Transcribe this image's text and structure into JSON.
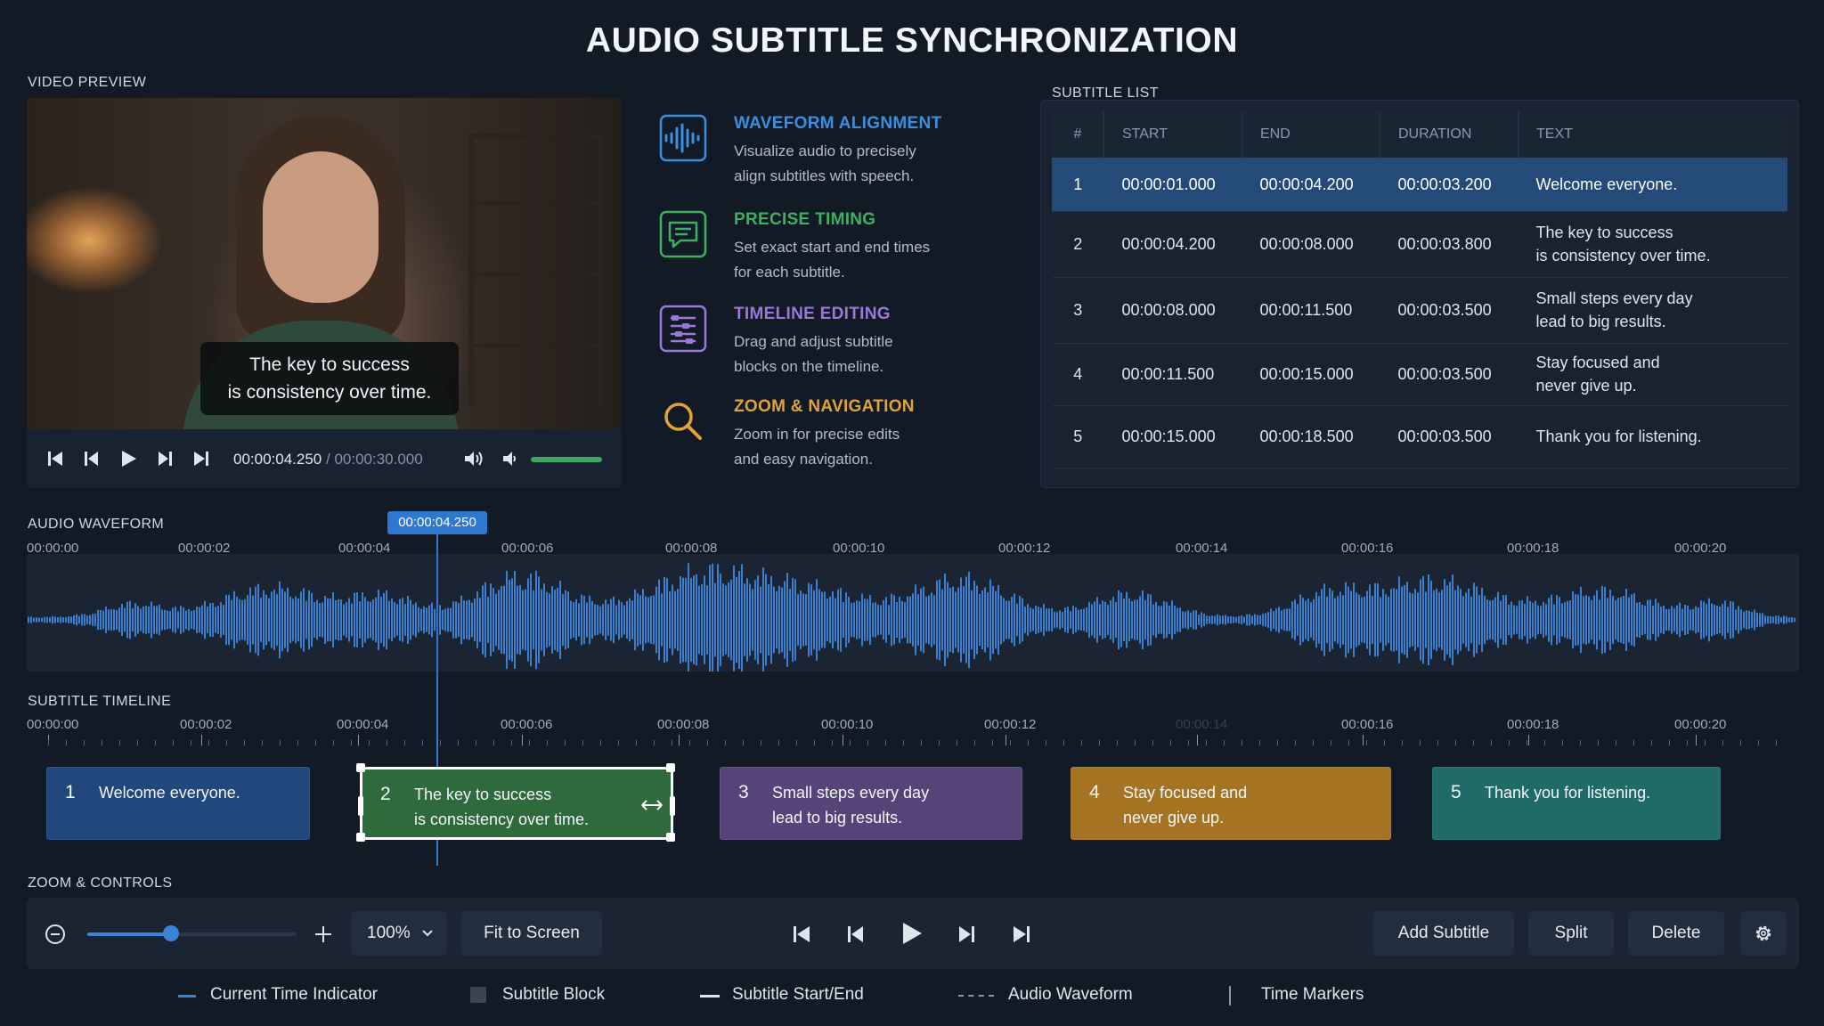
{
  "title": "AUDIO SUBTITLE SYNCHRONIZATION",
  "colors": {
    "background": "#121a25",
    "panel": "#182230",
    "accent_blue": "#3b83d6",
    "waveform": "#3a7fd0",
    "block_1": "#21477d",
    "block_2": "#2f6a3d",
    "block_3": "#564478",
    "block_4": "#a47422",
    "block_5": "#1f6b67"
  },
  "video_preview": {
    "label": "VIDEO PREVIEW",
    "subtitle_line1": "The key to success",
    "subtitle_line2": "is consistency over time.",
    "current_time": "00:00:04.250",
    "separator": " / ",
    "total_time": "00:00:30.000",
    "volume_level": 1.0,
    "icons": [
      "skip-to-start-icon",
      "previous-frame-icon",
      "play-icon",
      "next-frame-icon",
      "skip-to-end-icon",
      "volume-icon",
      "volume-low-icon"
    ]
  },
  "features": [
    {
      "title": "WAVEFORM ALIGNMENT",
      "desc_line1": "Visualize audio to precisely",
      "desc_line2": "align subtitles with speech.",
      "color": "#3b8fe0",
      "icon": "waveform-icon"
    },
    {
      "title": "PRECISE TIMING",
      "desc_line1": "Set exact start and end times",
      "desc_line2": "for each subtitle.",
      "color": "#3fae63",
      "icon": "chat-bubble-icon"
    },
    {
      "title": "TIMELINE EDITING",
      "desc_line1": "Drag and adjust subtitle",
      "desc_line2": "blocks on the timeline.",
      "color": "#9a78d6",
      "icon": "timeline-icon"
    },
    {
      "title": "ZOOM & NAVIGATION",
      "desc_line1": "Zoom in for precise edits",
      "desc_line2": "and easy navigation.",
      "color": "#e0a23a",
      "icon": "magnifier-icon"
    }
  ],
  "subtitle_list": {
    "label": "SUBTITLE LIST",
    "columns": [
      "#",
      "START",
      "END",
      "DURATION",
      "TEXT"
    ],
    "rows": [
      {
        "num": "1",
        "start": "00:00:01.000",
        "end": "00:00:04.200",
        "duration": "00:00:03.200",
        "text_line1": "Welcome everyone.",
        "text_line2": "",
        "selected": true
      },
      {
        "num": "2",
        "start": "00:00:04.200",
        "end": "00:00:08.000",
        "duration": "00:00:03.800",
        "text_line1": "The key to success",
        "text_line2": "is consistency over time.",
        "selected": false
      },
      {
        "num": "3",
        "start": "00:00:08.000",
        "end": "00:00:11.500",
        "duration": "00:00:03.500",
        "text_line1": "Small steps every day",
        "text_line2": "lead to big results.",
        "selected": false
      },
      {
        "num": "4",
        "start": "00:00:11.500",
        "end": "00:00:15.000",
        "duration": "00:00:03.500",
        "text_line1": "Stay focused and",
        "text_line2": "never give up.",
        "selected": false
      },
      {
        "num": "5",
        "start": "00:00:15.000",
        "end": "00:00:18.500",
        "duration": "00:00:03.500",
        "text_line1": "Thank you for listening.",
        "text_line2": "",
        "selected": false
      }
    ]
  },
  "audio_waveform": {
    "label": "AUDIO WAVEFORM",
    "playhead_time": "00:00:04.250",
    "playhead_seconds": 4.25,
    "range_seconds": [
      0,
      21
    ],
    "ticks": [
      "00:00:00",
      "00:00:02",
      "00:00:04",
      "00:00:06",
      "00:00:08",
      "00:00:10",
      "00:00:12",
      "00:00:14",
      "00:00:16",
      "00:00:18",
      "00:00:20"
    ]
  },
  "subtitle_timeline": {
    "label": "SUBTITLE TIMELINE",
    "ticks": [
      "00:00:00",
      "00:00:02",
      "00:00:04",
      "00:00:06",
      "00:00:08",
      "00:00:10",
      "00:00:12",
      "00:00:14",
      "00:00:16",
      "00:00:18",
      "00:00:20"
    ],
    "blocks": [
      {
        "num": "1",
        "line1": "Welcome everyone.",
        "line2": "",
        "color": "#21477d",
        "selected": false
      },
      {
        "num": "2",
        "line1": "The key to success",
        "line2": "is consistency over time.",
        "color": "#2f6a3d",
        "selected": true
      },
      {
        "num": "3",
        "line1": "Small steps every day",
        "line2": "lead to big results.",
        "color": "#564478",
        "selected": false
      },
      {
        "num": "4",
        "line1": "Stay focused and",
        "line2": "never give up.",
        "color": "#a47422",
        "selected": false
      },
      {
        "num": "5",
        "line1": "Thank you for listening.",
        "line2": "",
        "color": "#1f6b67",
        "selected": false
      }
    ]
  },
  "controls": {
    "label": "ZOOM & CONTROLS",
    "zoom_value": "100%",
    "zoom_slider_level": 0.4,
    "fit_to_screen": "Fit to Screen",
    "add_subtitle": "Add Subtitle",
    "split": "Split",
    "delete": "Delete",
    "icons": [
      "zoom-out-icon",
      "zoom-in-icon",
      "chevron-down-icon",
      "skip-to-start-icon",
      "previous-frame-icon",
      "play-icon",
      "next-frame-icon",
      "skip-to-end-icon",
      "gear-icon"
    ]
  },
  "legend": [
    {
      "label": "Current Time Indicator",
      "icon": "blue-line-icon"
    },
    {
      "label": "Subtitle Block",
      "icon": "square-icon"
    },
    {
      "label": "Subtitle Start/End",
      "icon": "white-line-icon"
    },
    {
      "label": "Audio Waveform",
      "icon": "dashed-line-icon"
    },
    {
      "label": "Time Markers",
      "icon": "vertical-bar-icon"
    }
  ]
}
